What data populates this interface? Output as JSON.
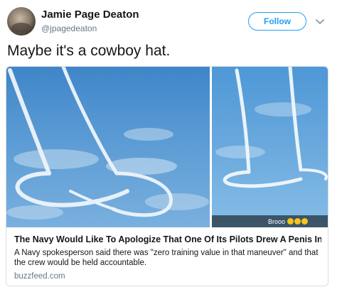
{
  "tweet": {
    "author_name": "Jamie Page Deaton",
    "author_handle": "@jpagedeaton",
    "follow_label": "Follow",
    "text": "Maybe it's a cowboy hat."
  },
  "card": {
    "image_caption": "Brooo",
    "title": "The Navy Would Like To Apologize That One Of Its Pilots Drew A Penis In T...",
    "description": "A Navy spokesperson said there was \"zero training value in that maneuver\" and that the crew would be held accountable.",
    "domain": "buzzfeed.com"
  },
  "colors": {
    "accent": "#1da1f2",
    "secondary_text": "#657786",
    "border": "#d7dde2"
  },
  "icons": {
    "more": "chevron-down-icon",
    "emoji": "grimacing-face-emoji"
  }
}
